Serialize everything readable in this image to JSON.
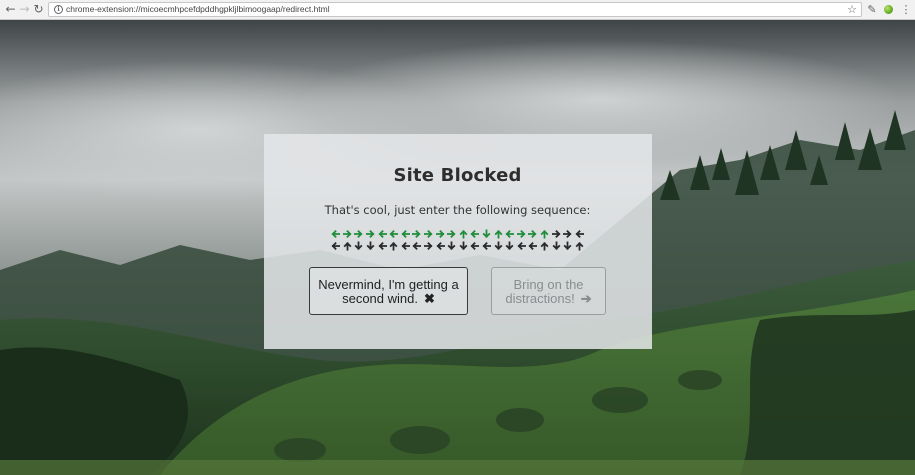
{
  "browser": {
    "url": "chrome-extension://micoecmhpcefdpddhgpkljlbimoogaap/redirect.html",
    "back_icon": "arrow-left-icon",
    "forward_icon": "arrow-right-icon",
    "reload_icon": "reload-icon",
    "star_icon": "star-icon",
    "extension_icon": "eyedropper-icon",
    "menu_icon": "vertical-dots-icon"
  },
  "modal": {
    "title": "Site Blocked",
    "subtitle": "That's cool, just enter the following sequence:",
    "sequence_rows": [
      [
        "left",
        "right",
        "right",
        "right",
        "left",
        "left",
        "left",
        "right",
        "right",
        "right",
        "right",
        "up",
        "left",
        "down",
        "up",
        "left",
        "right",
        "right",
        "up",
        "right",
        "right",
        "left"
      ],
      [
        "left",
        "up",
        "down",
        "down",
        "left",
        "up",
        "left",
        "left",
        "right",
        "left",
        "down",
        "down",
        "left",
        "left",
        "down",
        "down",
        "left",
        "left",
        "up",
        "down",
        "down",
        "up"
      ]
    ],
    "sequence_entered": 19,
    "entered_color": "#1f8e3a",
    "pending_color": "#2a2a2a",
    "nevermind_label": "Nevermind, I'm getting a second wind.",
    "nevermind_icon": "✖",
    "distract_label": "Bring on the distractions!",
    "distract_icon": "➔"
  }
}
